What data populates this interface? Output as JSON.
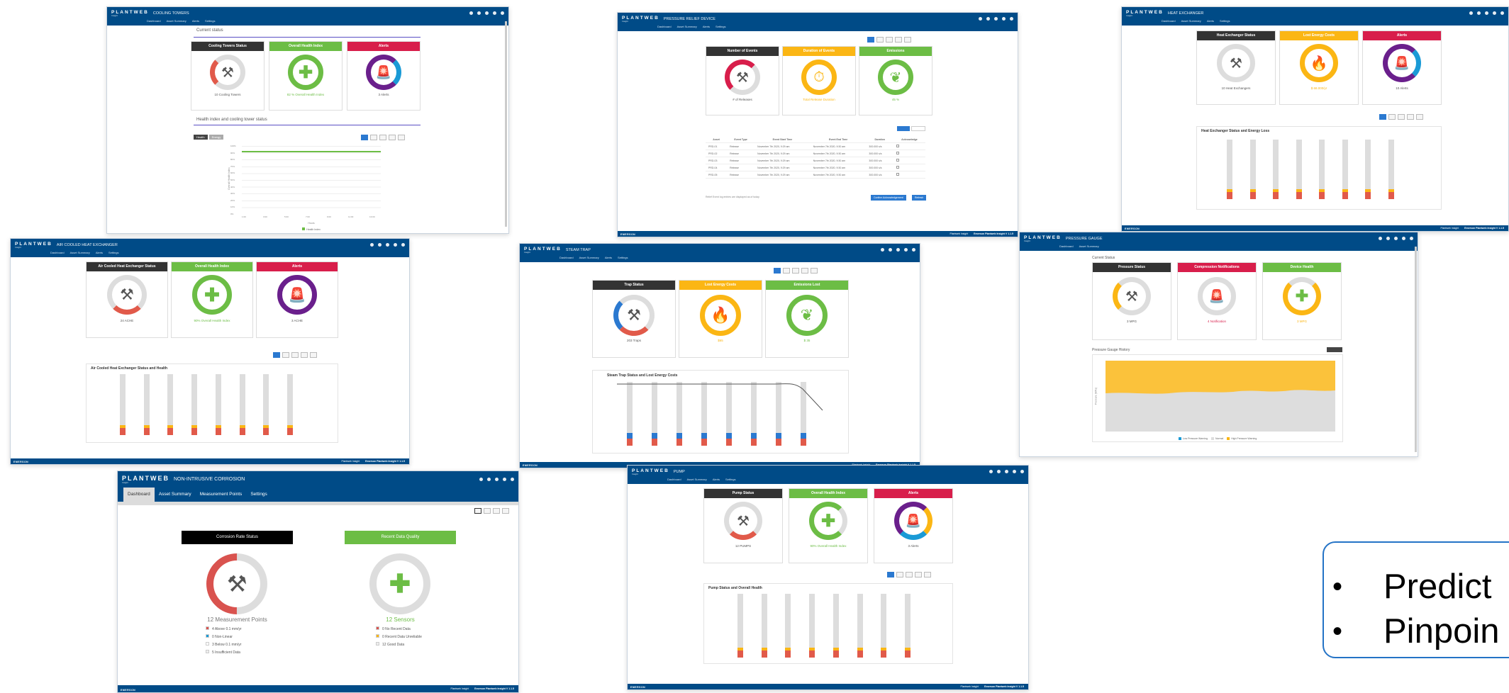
{
  "app": {
    "brand": "PLANTWEB",
    "brand_sub": "Insight",
    "footer_text": "Emerson Plantweb Insight V 1.1.5",
    "footer_pre": "Plantweb Insight",
    "emerson": "EMERSON"
  },
  "nav": [
    "Dashboard",
    "Asset Summary",
    "Alerts",
    "Settings"
  ],
  "cooling": {
    "title": "COOLING TOWERS",
    "section1": "Current status",
    "section2": "Health index and cooling tower status",
    "cards": [
      "Cooling Towers Status",
      "Overall Health Index",
      "Alerts"
    ],
    "g1": "10 Cooling Towers",
    "g2": "82 % Overall Health Index",
    "g3": "3 Alerts",
    "tabs": [
      "Health",
      "Energy"
    ],
    "ylabel": "Overall Health Index",
    "xlabel": "Hours",
    "legend": "Health Index",
    "yticks": [
      "100%",
      "90%",
      "80%",
      "70%",
      "60%",
      "50%",
      "40%",
      "30%",
      "20%",
      "10%",
      "0%"
    ],
    "xticks": [
      "1:00",
      "3:00",
      "5:00",
      "7:00",
      "9:00",
      "11:00",
      "13:00"
    ]
  },
  "relief": {
    "title": "PRESSURE RELIEF DEVICE",
    "cards": [
      "Number of Events",
      "Duration of Events",
      "Emissions"
    ],
    "g1": "# of Releases",
    "g2": "Total Release Duration",
    "g3": "45 %",
    "table_headers": [
      "Asset",
      "Event Type",
      "Event Start Time",
      "Event End Time",
      "Duration",
      "Acknowledge"
    ],
    "rows": [
      [
        "PRD-01",
        "Release",
        "November 7th 2020, 9:29 am",
        "November 7th 2020, 9:30 am",
        "300.000 s/s"
      ],
      [
        "PRD-02",
        "Release",
        "November 7th 2020, 9:29 am",
        "November 7th 2020, 9:30 am",
        "300.000 s/s"
      ],
      [
        "PRD-03",
        "Release",
        "November 7th 2020, 9:29 am",
        "November 7th 2020, 9:30 am",
        "300.000 s/s"
      ],
      [
        "PRD-04",
        "Release",
        "November 7th 2020, 9:29 am",
        "November 7th 2020, 9:30 am",
        "300.000 s/s"
      ],
      [
        "PRD-05",
        "Release",
        "November 7th 2020, 9:29 am",
        "November 7th 2020, 9:30 am",
        "300.000 s/s"
      ]
    ],
    "note": "Relief Event log entries are displayed as of today",
    "buttons": [
      "Confirm Acknowledgement",
      "Refresh"
    ]
  },
  "heatex": {
    "title": "HEAT EXCHANGER",
    "cards": [
      "Heat Exchanger Status",
      "Lost Energy Costs",
      "Alerts"
    ],
    "g1": "10 Heat Exchangers",
    "g2": "$ 68.000/yr",
    "g3": "10 Alerts",
    "chart_title": "Heat Exchanger Status and Energy Loss"
  },
  "aircooled": {
    "title": "AIR COOLED HEAT EXCHANGER",
    "cards": [
      "Air Cooled Heat Exchanger Status",
      "Overall Health Index",
      "Alerts"
    ],
    "g1": "24 ACHE",
    "g2": "90% Overall Health Index",
    "g3": "3 ACHE",
    "chart_title": "Air Cooled Heat Exchanger Status and Health"
  },
  "steam": {
    "title": "STEAM TRAP",
    "cards": [
      "Trap Status",
      "Lost Energy Costs",
      "Emissions Lost"
    ],
    "g1": "203 Traps",
    "g2": "$65",
    "g3": "$ 35",
    "chart_title": "Steam Trap Status and Lost Energy Costs"
  },
  "pressure": {
    "title": "PRESSURE GAUGE",
    "section1": "Current Status",
    "cards": [
      "Pressure Status",
      "Compression Notifications",
      "Device Health"
    ],
    "g1": "3 MPG",
    "g2": "4 Notification",
    "g3": "3 MPG",
    "section2": "Pressure Gauge History",
    "ylabel": "Pressure (MPa)",
    "legend": [
      "Low Pressure Warning",
      "Normal",
      "High Pressure Warning"
    ]
  },
  "corrosion": {
    "title": "NON-INTRUSIVE CORROSION",
    "tabs": [
      "Dashboard",
      "Asset Summary",
      "Measurement Points",
      "Settings"
    ],
    "card1": "Corrosion Rate Status",
    "card2": "Recent Data Quality",
    "g1": "12 Measurement Points",
    "g2": "12 Sensors",
    "legend1": [
      "4 Above 0.1 mm/yr",
      "0 Non-Linear",
      "3 Below 0.1 mm/yr",
      "5 Insufficient Data"
    ],
    "legend2": [
      "0 No Recent Data",
      "0 Recent Data Unreliable",
      "12 Good Data"
    ]
  },
  "pump": {
    "title": "PUMP",
    "cards": [
      "Pump Status",
      "Overall Health Index",
      "Alerts"
    ],
    "g1": "12 PUMPS",
    "g2": "90% Overall Health Index",
    "g3": "3 Alerts",
    "chart_title": "Pump Status and Overall Health"
  },
  "callout": {
    "items": [
      "Predict",
      "Pinpoin"
    ]
  },
  "colors": {
    "header": "#004b87",
    "green": "#6cbd45",
    "red": "#d81e4b",
    "yellow": "#fbb614",
    "purple": "#6a1f8c",
    "accent": "#2473c6"
  }
}
